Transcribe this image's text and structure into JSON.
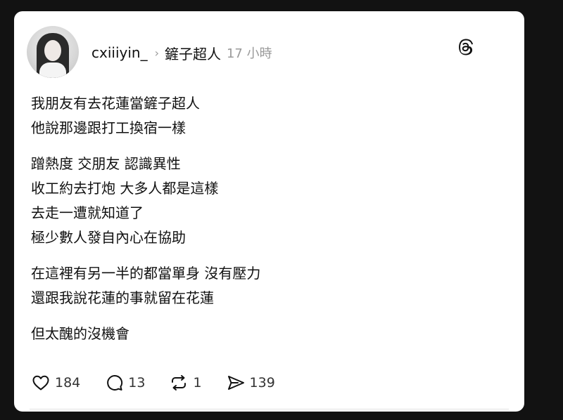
{
  "post": {
    "username": "cxiiiyin_",
    "separator_icon": "chevron-right-icon",
    "topic": "鏟子超人",
    "time": "17 小時",
    "app_logo_icon": "threads-logo-icon",
    "paragraphs": [
      [
        "我朋友有去花蓮當鏟子超人",
        "他說那邊跟打工換宿一樣"
      ],
      [
        "蹭熱度 交朋友 認識異性",
        "收工約去打炮 大多人都是這樣",
        "去走一遭就知道了",
        "極少數人發自內心在協助"
      ],
      [
        "在這裡有另一半的都當單身 沒有壓力",
        "還跟我說花蓮的事就留在花蓮"
      ],
      [
        "但太醜的沒機會"
      ]
    ],
    "actions": {
      "like": {
        "icon": "heart-icon",
        "count": "184"
      },
      "reply": {
        "icon": "comment-icon",
        "count": "13"
      },
      "repost": {
        "icon": "repost-icon",
        "count": "1"
      },
      "share": {
        "icon": "send-icon",
        "count": "139"
      }
    }
  },
  "colors": {
    "background": "#121212",
    "card": "#ffffff",
    "text": "#111111",
    "muted": "#9a9a9a"
  }
}
